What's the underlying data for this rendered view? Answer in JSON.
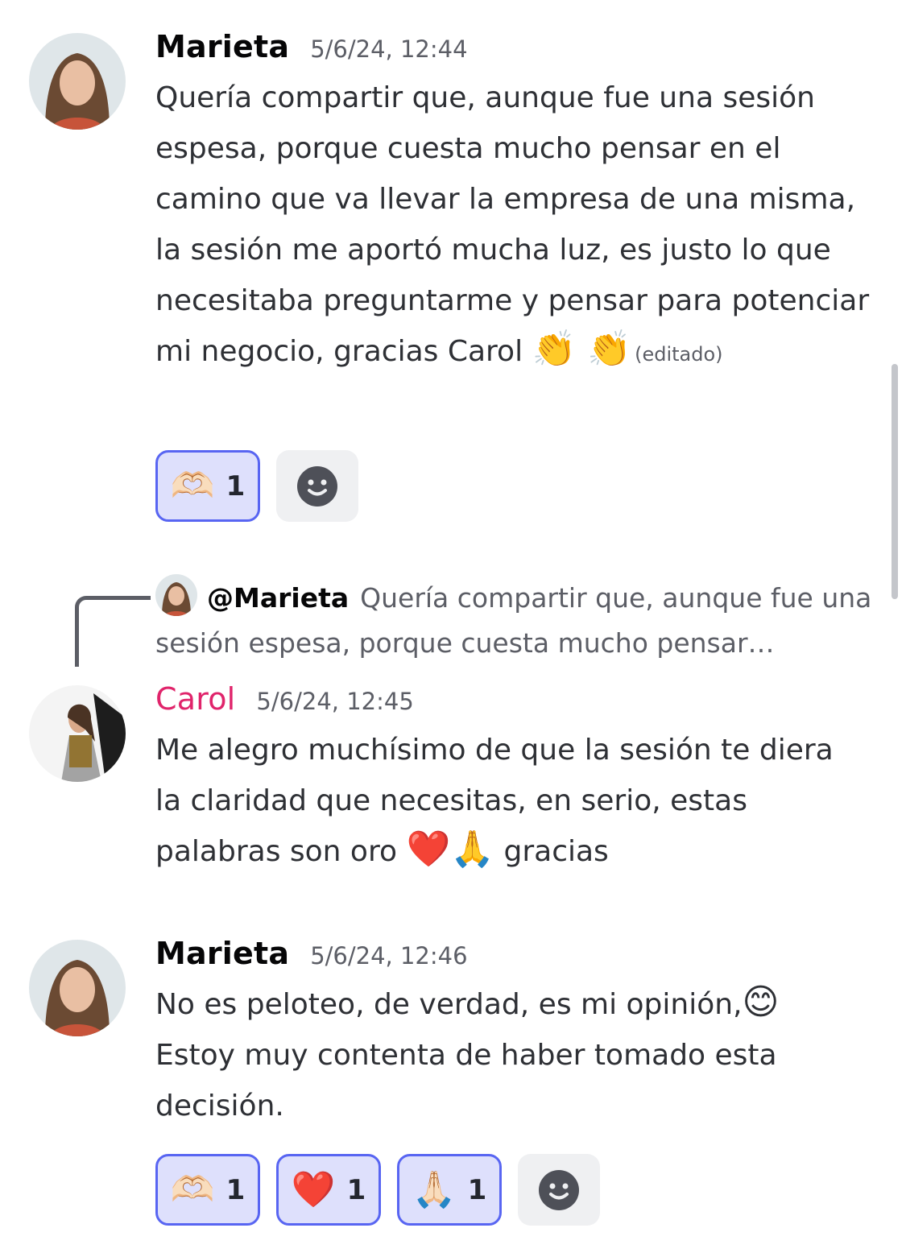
{
  "messages": [
    {
      "author": "Marieta",
      "timestamp": "5/6/24, 12:44",
      "text": "Quería compartir que, aunque fue una sesión espesa, porque cuesta mucho pensar en el camino que va llevar la empresa de una misma, la sesión me aportó mucha luz, es justo lo que necesitaba preguntarme y pensar para potenciar mi negocio, gracias Carol",
      "emojis": "👏 👏",
      "edited": "(editado)",
      "reactions": [
        {
          "emoji": "🫶🏻",
          "count": "1"
        }
      ]
    },
    {
      "reply": {
        "mention": "@Marieta",
        "preview": "Quería compartir que, aunque fue una sesión espesa, porque cuesta mucho pensar…"
      },
      "author": "Carol",
      "timestamp": "5/6/24, 12:45",
      "text": "Me alegro muchísimo de que la sesión te diera la claridad que necesitas, en serio, estas palabras son oro",
      "emojis": "❤️🙏",
      "text_after": "gracias"
    },
    {
      "author": "Marieta",
      "timestamp": "5/6/24, 12:46",
      "text": "No es peloteo, de verdad, es mi opinión,",
      "emojis": "😊",
      "text_after": "Estoy muy contenta de haber tomado esta decisión.",
      "reactions": [
        {
          "emoji": "🫶🏻",
          "count": "1"
        },
        {
          "emoji": "❤️",
          "count": "1"
        },
        {
          "emoji": "🙏🏻",
          "count": "1"
        }
      ]
    }
  ],
  "colors": {
    "author_carol": "#e0246b",
    "reaction_border": "#5865f2",
    "reaction_bg": "#dee0fc"
  }
}
